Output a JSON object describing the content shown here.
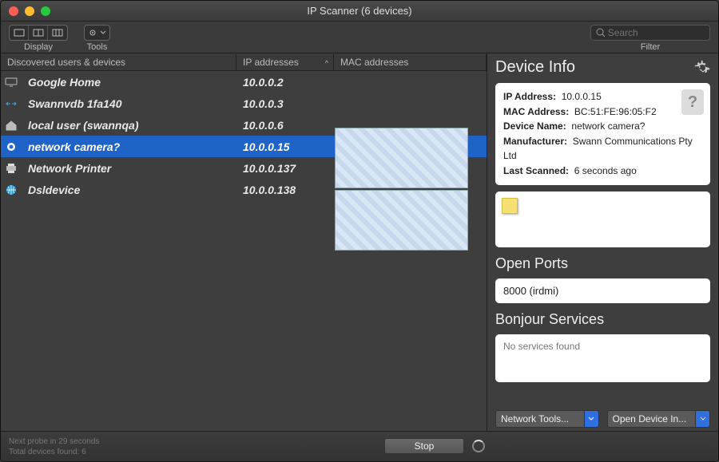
{
  "window": {
    "title": "IP Scanner (6 devices)"
  },
  "toolbar": {
    "display_label": "Display",
    "tools_label": "Tools",
    "search_placeholder": "Search",
    "filter_label": "Filter"
  },
  "columns": {
    "name": "Discovered users & devices",
    "ip": "IP addresses",
    "mac": "MAC addresses"
  },
  "devices": [
    {
      "icon": "display",
      "name": "Google Home",
      "ip": "10.0.0.2",
      "mac": "",
      "selected": false
    },
    {
      "icon": "link",
      "name": "Swannvdb 1fa140",
      "ip": "10.0.0.3",
      "mac": "",
      "selected": false
    },
    {
      "icon": "home",
      "name": "local user (swannqa)",
      "ip": "10.0.0.6",
      "mac": "",
      "selected": false
    },
    {
      "icon": "camera",
      "name": "network camera?",
      "ip": "10.0.0.15",
      "mac": "BC:51:FE:96:05:F2",
      "selected": true
    },
    {
      "icon": "printer",
      "name": "Network Printer",
      "ip": "10.0.0.137",
      "mac": "",
      "selected": false
    },
    {
      "icon": "globe",
      "name": "Dsldevice",
      "ip": "10.0.0.138",
      "mac": "",
      "selected": false
    }
  ],
  "device_info": {
    "heading": "Device Info",
    "labels": {
      "ip": "IP Address:",
      "mac": "MAC Address:",
      "name": "Device Name:",
      "manufacturer": "Manufacturer:",
      "last_scanned": "Last Scanned:"
    },
    "values": {
      "ip": "10.0.0.15",
      "mac": "BC:51:FE:96:05:F2",
      "name": "network camera?",
      "manufacturer": "Swann Communications Pty Ltd",
      "last_scanned": "6 seconds ago"
    }
  },
  "open_ports": {
    "heading": "Open Ports",
    "value": "8000 (irdmi)"
  },
  "bonjour": {
    "heading": "Bonjour Services",
    "text": "No services found"
  },
  "right_buttons": {
    "network_tools": "Network Tools...",
    "open_device": "Open Device In..."
  },
  "footer": {
    "line1": "Next probe in 29 seconds",
    "line2": "Total devices found: 6",
    "stop": "Stop"
  }
}
